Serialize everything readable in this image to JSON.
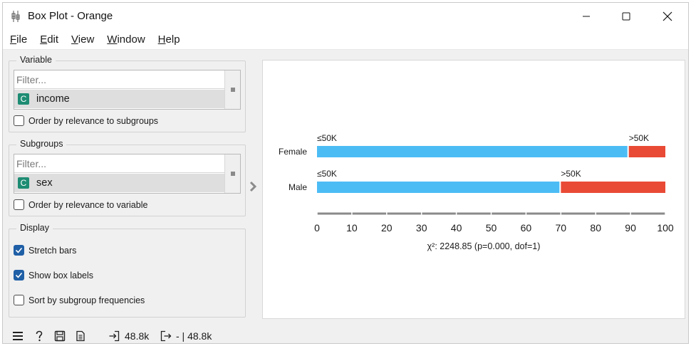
{
  "window": {
    "title": "Box Plot - Orange",
    "icon": "orange-boxplot-app-icon"
  },
  "menu": [
    {
      "label": "File",
      "u": "F",
      "rest": "ile"
    },
    {
      "label": "Edit",
      "u": "E",
      "rest": "dit"
    },
    {
      "label": "View",
      "u": "V",
      "rest": "iew"
    },
    {
      "label": "Window",
      "u": "W",
      "rest": "indow"
    },
    {
      "label": "Help",
      "u": "H",
      "rest": "elp"
    }
  ],
  "variable": {
    "title": "Variable",
    "filter_placeholder": "Filter...",
    "item_type": "C",
    "item_label": "income",
    "checkbox_label": "Order by relevance to subgroups",
    "checked": false
  },
  "subgroups": {
    "title": "Subgroups",
    "filter_placeholder": "Filter...",
    "item_type": "C",
    "item_label": "sex",
    "checkbox_label": "Order by relevance to variable",
    "checked": false
  },
  "display": {
    "title": "Display",
    "options": [
      {
        "label": "Stretch bars",
        "checked": true
      },
      {
        "label": "Show box labels",
        "checked": true
      },
      {
        "label": "Sort by subgroup frequencies",
        "checked": false
      }
    ]
  },
  "status": {
    "input_count": "48.8k",
    "output_text": "- | 48.8k"
  },
  "colors": {
    "low": "#4cbcf5",
    "high": "#e94a35"
  },
  "chart_data": {
    "type": "bar",
    "stacked": true,
    "orientation": "horizontal",
    "categories": [
      "Female",
      "Male"
    ],
    "series": [
      {
        "name": "≤50K",
        "values": [
          89.1,
          69.6
        ]
      },
      {
        "name": ">50K",
        "values": [
          10.9,
          30.4
        ]
      }
    ],
    "xlim": [
      0,
      100
    ],
    "x_ticks": [
      "0",
      "10",
      "20",
      "30",
      "40",
      "50",
      "60",
      "70",
      "80",
      "90",
      "100"
    ],
    "stat_text": "χ²: 2248.85 (p=0.000, dof=1)"
  }
}
